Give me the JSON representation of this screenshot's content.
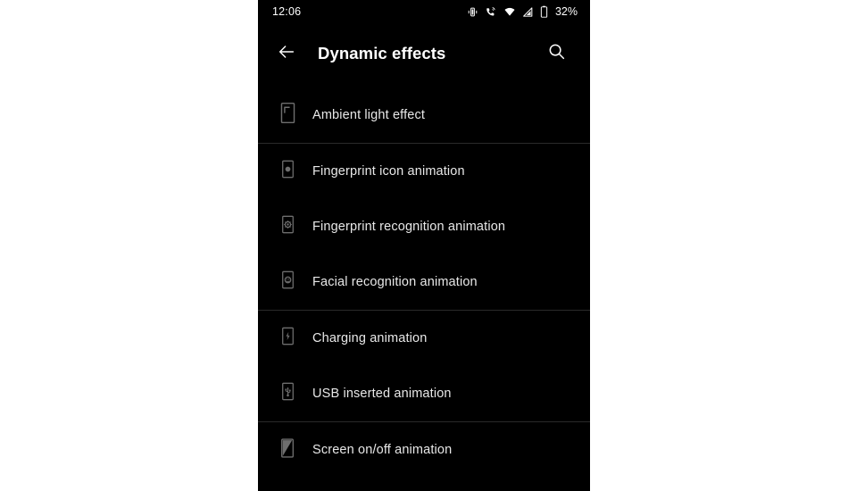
{
  "status_bar": {
    "clock": "12:06",
    "battery_percent": "32%",
    "icons": [
      "vibrate-icon",
      "call-forwarding-icon",
      "wifi-icon",
      "cellular-signal-icon",
      "battery-icon"
    ]
  },
  "app_bar": {
    "back_icon": "back-arrow-icon",
    "title": "Dynamic effects",
    "search_icon": "search-icon"
  },
  "groups": [
    {
      "items": [
        {
          "label": "Ambient light effect",
          "icon": "phone-ambient-light-icon"
        }
      ]
    },
    {
      "items": [
        {
          "label": "Fingerprint icon animation",
          "icon": "phone-fingerprint-dot-icon"
        },
        {
          "label": "Fingerprint recognition animation",
          "icon": "phone-fingerprint-ring-icon"
        },
        {
          "label": "Facial recognition animation",
          "icon": "phone-face-icon"
        }
      ]
    },
    {
      "items": [
        {
          "label": "Charging animation",
          "icon": "phone-charging-bolt-icon"
        },
        {
          "label": "USB inserted animation",
          "icon": "phone-usb-icon"
        }
      ]
    },
    {
      "items": [
        {
          "label": "Screen on/off animation",
          "icon": "phone-screen-onoff-icon"
        }
      ]
    }
  ],
  "colors": {
    "screen_background": "#000000",
    "page_background": "#ffffff",
    "primary_text": "#ffffff",
    "item_text": "#e8e8e8",
    "icon": "#6e6e6e",
    "divider": "#2a2a2a"
  }
}
